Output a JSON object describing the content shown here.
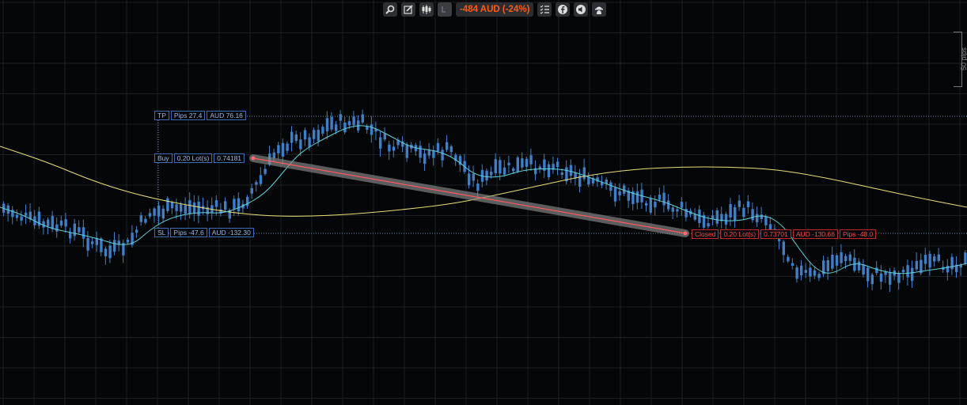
{
  "toolbar": {
    "icons": [
      "zoom-icon",
      "edit-chart-icon",
      "candlestick-icon",
      "tag-icon",
      "list-icon",
      "facebook-icon",
      "sound-icon",
      "profile-icon"
    ],
    "pnl": "-484 AUD (-24%)"
  },
  "scale": {
    "label": "50 pips"
  },
  "trade": {
    "tp": {
      "type": "TP",
      "pips": "Pips 27.4",
      "amount": "AUD 76.16"
    },
    "buy": {
      "type": "Buy",
      "lots": "0.20 Lot(s)",
      "price": "0.74181"
    },
    "sl": {
      "type": "SL",
      "pips": "Pips -47.6",
      "amount": "AUD -132.30"
    },
    "closed": {
      "type": "Closed",
      "lots": "0.20 Lot(s)",
      "price": "0.73701",
      "amount": "AUD -130.66",
      "pips": "Pips -48.0"
    }
  },
  "colors": {
    "candle": "#3f7fc8",
    "fast_ma": "#5fd0d8",
    "slow_ma": "#e8e07a",
    "trade_line": "#ff5a5f",
    "background": "#050607",
    "pnl": "#ff5a14"
  }
}
